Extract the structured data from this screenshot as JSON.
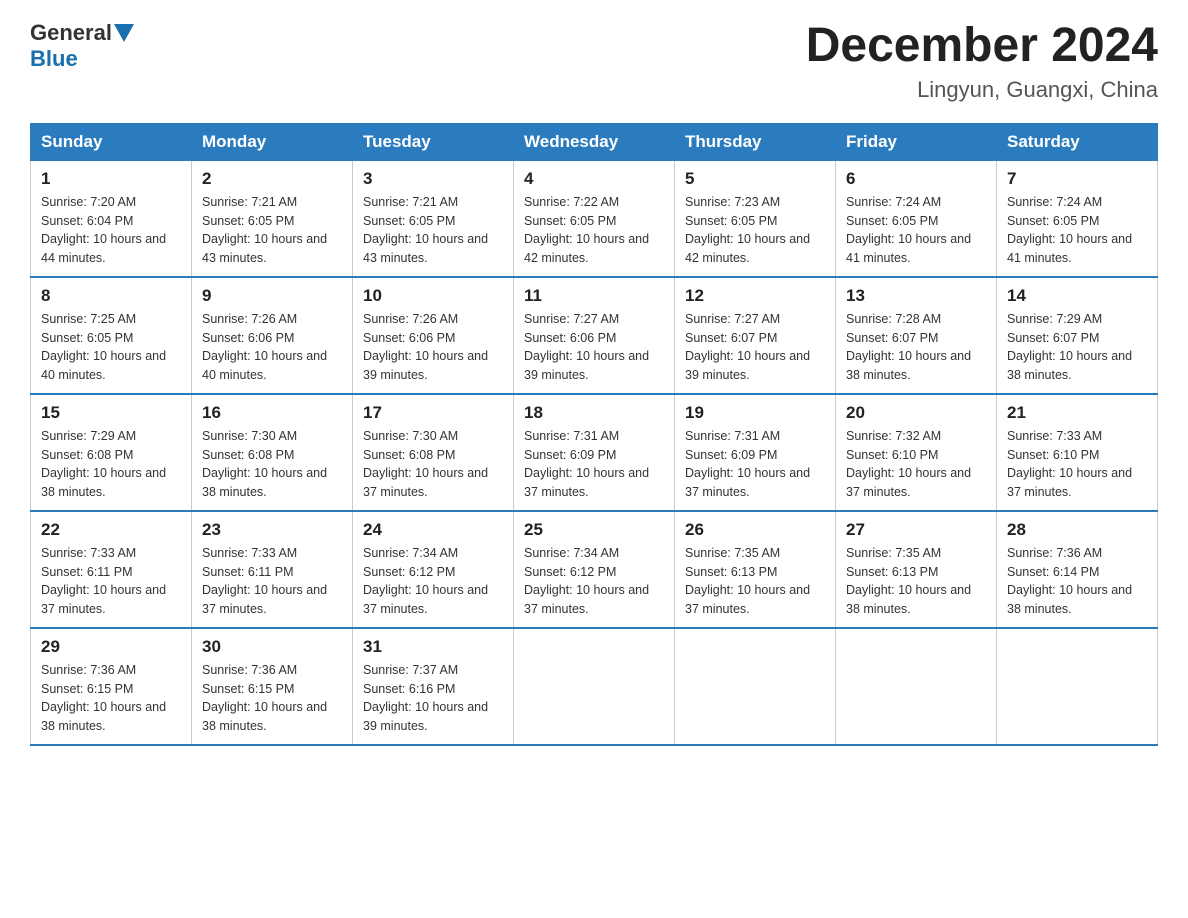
{
  "logo": {
    "general": "General",
    "blue": "Blue"
  },
  "title": "December 2024",
  "location": "Lingyun, Guangxi, China",
  "days_of_week": [
    "Sunday",
    "Monday",
    "Tuesday",
    "Wednesday",
    "Thursday",
    "Friday",
    "Saturday"
  ],
  "weeks": [
    [
      {
        "day": "1",
        "sunrise": "7:20 AM",
        "sunset": "6:04 PM",
        "daylight": "10 hours and 44 minutes."
      },
      {
        "day": "2",
        "sunrise": "7:21 AM",
        "sunset": "6:05 PM",
        "daylight": "10 hours and 43 minutes."
      },
      {
        "day": "3",
        "sunrise": "7:21 AM",
        "sunset": "6:05 PM",
        "daylight": "10 hours and 43 minutes."
      },
      {
        "day": "4",
        "sunrise": "7:22 AM",
        "sunset": "6:05 PM",
        "daylight": "10 hours and 42 minutes."
      },
      {
        "day": "5",
        "sunrise": "7:23 AM",
        "sunset": "6:05 PM",
        "daylight": "10 hours and 42 minutes."
      },
      {
        "day": "6",
        "sunrise": "7:24 AM",
        "sunset": "6:05 PM",
        "daylight": "10 hours and 41 minutes."
      },
      {
        "day": "7",
        "sunrise": "7:24 AM",
        "sunset": "6:05 PM",
        "daylight": "10 hours and 41 minutes."
      }
    ],
    [
      {
        "day": "8",
        "sunrise": "7:25 AM",
        "sunset": "6:05 PM",
        "daylight": "10 hours and 40 minutes."
      },
      {
        "day": "9",
        "sunrise": "7:26 AM",
        "sunset": "6:06 PM",
        "daylight": "10 hours and 40 minutes."
      },
      {
        "day": "10",
        "sunrise": "7:26 AM",
        "sunset": "6:06 PM",
        "daylight": "10 hours and 39 minutes."
      },
      {
        "day": "11",
        "sunrise": "7:27 AM",
        "sunset": "6:06 PM",
        "daylight": "10 hours and 39 minutes."
      },
      {
        "day": "12",
        "sunrise": "7:27 AM",
        "sunset": "6:07 PM",
        "daylight": "10 hours and 39 minutes."
      },
      {
        "day": "13",
        "sunrise": "7:28 AM",
        "sunset": "6:07 PM",
        "daylight": "10 hours and 38 minutes."
      },
      {
        "day": "14",
        "sunrise": "7:29 AM",
        "sunset": "6:07 PM",
        "daylight": "10 hours and 38 minutes."
      }
    ],
    [
      {
        "day": "15",
        "sunrise": "7:29 AM",
        "sunset": "6:08 PM",
        "daylight": "10 hours and 38 minutes."
      },
      {
        "day": "16",
        "sunrise": "7:30 AM",
        "sunset": "6:08 PM",
        "daylight": "10 hours and 38 minutes."
      },
      {
        "day": "17",
        "sunrise": "7:30 AM",
        "sunset": "6:08 PM",
        "daylight": "10 hours and 37 minutes."
      },
      {
        "day": "18",
        "sunrise": "7:31 AM",
        "sunset": "6:09 PM",
        "daylight": "10 hours and 37 minutes."
      },
      {
        "day": "19",
        "sunrise": "7:31 AM",
        "sunset": "6:09 PM",
        "daylight": "10 hours and 37 minutes."
      },
      {
        "day": "20",
        "sunrise": "7:32 AM",
        "sunset": "6:10 PM",
        "daylight": "10 hours and 37 minutes."
      },
      {
        "day": "21",
        "sunrise": "7:33 AM",
        "sunset": "6:10 PM",
        "daylight": "10 hours and 37 minutes."
      }
    ],
    [
      {
        "day": "22",
        "sunrise": "7:33 AM",
        "sunset": "6:11 PM",
        "daylight": "10 hours and 37 minutes."
      },
      {
        "day": "23",
        "sunrise": "7:33 AM",
        "sunset": "6:11 PM",
        "daylight": "10 hours and 37 minutes."
      },
      {
        "day": "24",
        "sunrise": "7:34 AM",
        "sunset": "6:12 PM",
        "daylight": "10 hours and 37 minutes."
      },
      {
        "day": "25",
        "sunrise": "7:34 AM",
        "sunset": "6:12 PM",
        "daylight": "10 hours and 37 minutes."
      },
      {
        "day": "26",
        "sunrise": "7:35 AM",
        "sunset": "6:13 PM",
        "daylight": "10 hours and 37 minutes."
      },
      {
        "day": "27",
        "sunrise": "7:35 AM",
        "sunset": "6:13 PM",
        "daylight": "10 hours and 38 minutes."
      },
      {
        "day": "28",
        "sunrise": "7:36 AM",
        "sunset": "6:14 PM",
        "daylight": "10 hours and 38 minutes."
      }
    ],
    [
      {
        "day": "29",
        "sunrise": "7:36 AM",
        "sunset": "6:15 PM",
        "daylight": "10 hours and 38 minutes."
      },
      {
        "day": "30",
        "sunrise": "7:36 AM",
        "sunset": "6:15 PM",
        "daylight": "10 hours and 38 minutes."
      },
      {
        "day": "31",
        "sunrise": "7:37 AM",
        "sunset": "6:16 PM",
        "daylight": "10 hours and 39 minutes."
      },
      null,
      null,
      null,
      null
    ]
  ]
}
